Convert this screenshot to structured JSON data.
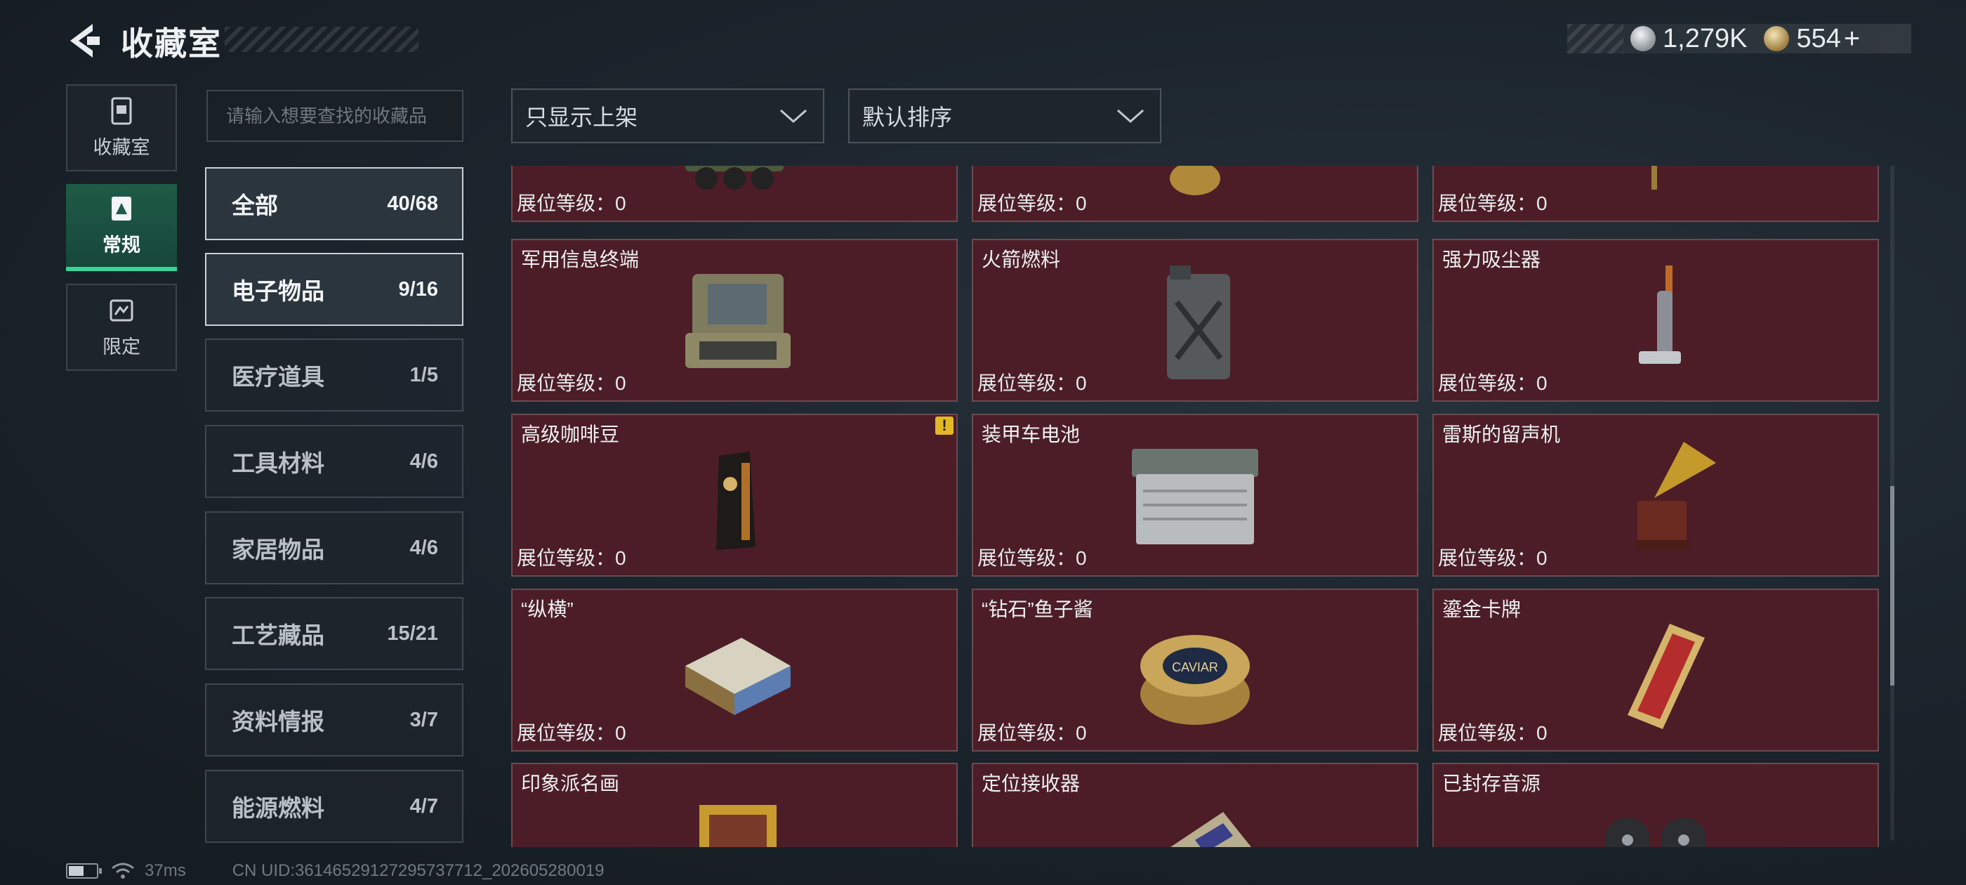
{
  "header": {
    "title": "收藏室"
  },
  "currency": [
    {
      "icon": "silver-coin-icon",
      "value": "1,279K"
    },
    {
      "icon": "gold-coin-icon",
      "value": "554"
    }
  ],
  "currency_add": "+",
  "nav": [
    {
      "label": "收藏室",
      "icon": "collection-room-icon",
      "active": false
    },
    {
      "label": "常规",
      "icon": "regular-icon",
      "active": true
    },
    {
      "label": "限定",
      "icon": "limited-icon",
      "active": false
    }
  ],
  "search": {
    "placeholder": "请输入想要查找的收藏品"
  },
  "filters": {
    "show_filter": "只显示上架",
    "sort": "默认排序"
  },
  "categories": [
    {
      "name": "全部",
      "count": "40/68",
      "selected": true
    },
    {
      "name": "电子物品",
      "count": "9/16",
      "selected": true
    },
    {
      "name": "医疗道具",
      "count": "1/5"
    },
    {
      "name": "工具材料",
      "count": "4/6"
    },
    {
      "name": "家居物品",
      "count": "4/6"
    },
    {
      "name": "工艺藏品",
      "count": "15/21"
    },
    {
      "name": "资料情报",
      "count": "3/7"
    },
    {
      "name": "能源燃料",
      "count": "4/7"
    }
  ],
  "level_label": "展位等级：0",
  "items": [
    {
      "name": "",
      "icon": "vehicle-icon",
      "level": "展位等级：0"
    },
    {
      "name": "",
      "icon": "gold-item-icon",
      "level": "展位等级：0"
    },
    {
      "name": "",
      "icon": "item-icon",
      "level": "展位等级：0"
    },
    {
      "name": "军用信息终端",
      "icon": "military-terminal-icon",
      "level": "展位等级：0"
    },
    {
      "name": "火箭燃料",
      "icon": "fuel-canister-icon",
      "level": "展位等级：0"
    },
    {
      "name": "强力吸尘器",
      "icon": "vacuum-cleaner-icon",
      "level": "展位等级：0"
    },
    {
      "name": "高级咖啡豆",
      "icon": "coffee-bag-icon",
      "level": "展位等级：0",
      "warning": "!"
    },
    {
      "name": "装甲车电池",
      "icon": "battery-icon",
      "level": "展位等级：0"
    },
    {
      "name": "雷斯的留声机",
      "icon": "gramophone-icon",
      "level": "展位等级：0"
    },
    {
      "name": "“纵横”",
      "icon": "chess-box-icon",
      "level": "展位等级：0"
    },
    {
      "name": "“钻石”鱼子酱",
      "icon": "caviar-tin-icon",
      "level": "展位等级：0",
      "art_text": "CAVIAR"
    },
    {
      "name": "鎏金卡牌",
      "icon": "gilded-card-icon",
      "level": "展位等级：0"
    },
    {
      "name": "印象派名画",
      "icon": "painting-icon",
      "level": ""
    },
    {
      "name": "定位接收器",
      "icon": "locator-receiver-icon",
      "level": ""
    },
    {
      "name": "已封存音源",
      "icon": "reel-recorder-icon",
      "level": ""
    }
  ],
  "footer": {
    "ping": "37ms",
    "uid": "CN UID:36146529127295737712_202605280019",
    "battery_level": 0.55
  },
  "colors": {
    "card_bg": "#4c1d26",
    "accent_green": "#38d49a",
    "warning": "#e3b825"
  }
}
